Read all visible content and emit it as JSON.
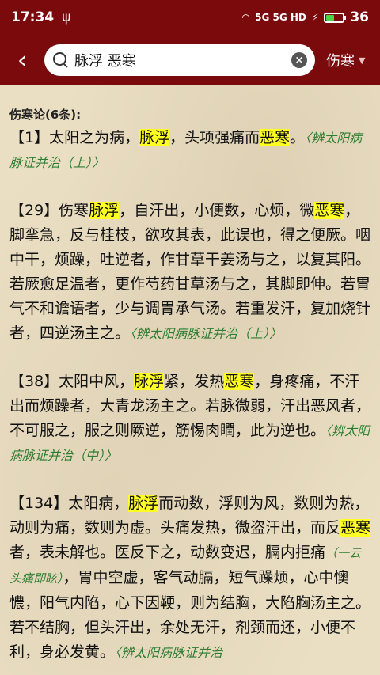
{
  "status": {
    "time": "17:34",
    "battery": "36",
    "indicators": "5G 5G HD"
  },
  "search": {
    "query": "脉浮 恶寒",
    "scope": "伤寒"
  },
  "section": {
    "title": "伤寒论(6条):"
  },
  "entries": [
    {
      "parts": [
        {
          "t": "【1】太阳之为病，"
        },
        {
          "t": "脉浮",
          "hl": true
        },
        {
          "t": "，头项强痛而"
        },
        {
          "t": "恶寒",
          "hl": true
        },
        {
          "t": "。"
        },
        {
          "t": "〈辨太阳病脉证并治（上）〉",
          "src": true
        }
      ]
    },
    {
      "parts": [
        {
          "t": "【29】伤寒"
        },
        {
          "t": "脉浮",
          "hl": true
        },
        {
          "t": "，自汗出，小便数，心烦，微"
        },
        {
          "t": "恶寒",
          "hl": true
        },
        {
          "t": "，脚挛急，反与桂枝，欲攻其表，此误也，得之便厥。咽中干，烦躁，吐逆者，作甘草干姜汤与之，以复其阳。若厥愈足温者，更作芍药甘草汤与之，其脚即伸。若胃气不和谵语者，少与调胃承气汤。若重发汗，复加烧针者，四逆汤主之。"
        },
        {
          "t": "〈辨太阳病脉证并治（上）〉",
          "src": true
        }
      ]
    },
    {
      "parts": [
        {
          "t": "【38】太阳中风，"
        },
        {
          "t": "脉浮",
          "hl": true
        },
        {
          "t": "紧，发热"
        },
        {
          "t": "恶寒",
          "hl": true
        },
        {
          "t": "，身疼痛，不汗出而烦躁者，大青龙汤主之。若脉微弱，汗出恶风者，不可服之，服之则厥逆，筋惕肉瞤，此为逆也。"
        },
        {
          "t": "〈辨太阳病脉证并治（中）〉",
          "src": true
        }
      ]
    },
    {
      "parts": [
        {
          "t": "【134】太阳病，"
        },
        {
          "t": "脉浮",
          "hl": true
        },
        {
          "t": "而动数，浮则为风，数则为热，动则为痛，数则为虚。头痛发热，微盗汗出，而反"
        },
        {
          "t": "恶寒",
          "hl": true
        },
        {
          "t": "者，表未解也。医反下之，动数变迟，膈内拒痛"
        },
        {
          "t": "（一云头痛即眩）",
          "note": true
        },
        {
          "t": "，胃中空虚，客气动膈，短气躁烦，心中懊憹，阳气内陷，心下因鞕，则为结胸，大陷胸汤主之。若不结胸，但头汗出，余处无汗，剂颈而还，小便不利，身必发黄。"
        },
        {
          "t": "〈辨太阳病脉证并治",
          "src": true
        }
      ]
    }
  ]
}
